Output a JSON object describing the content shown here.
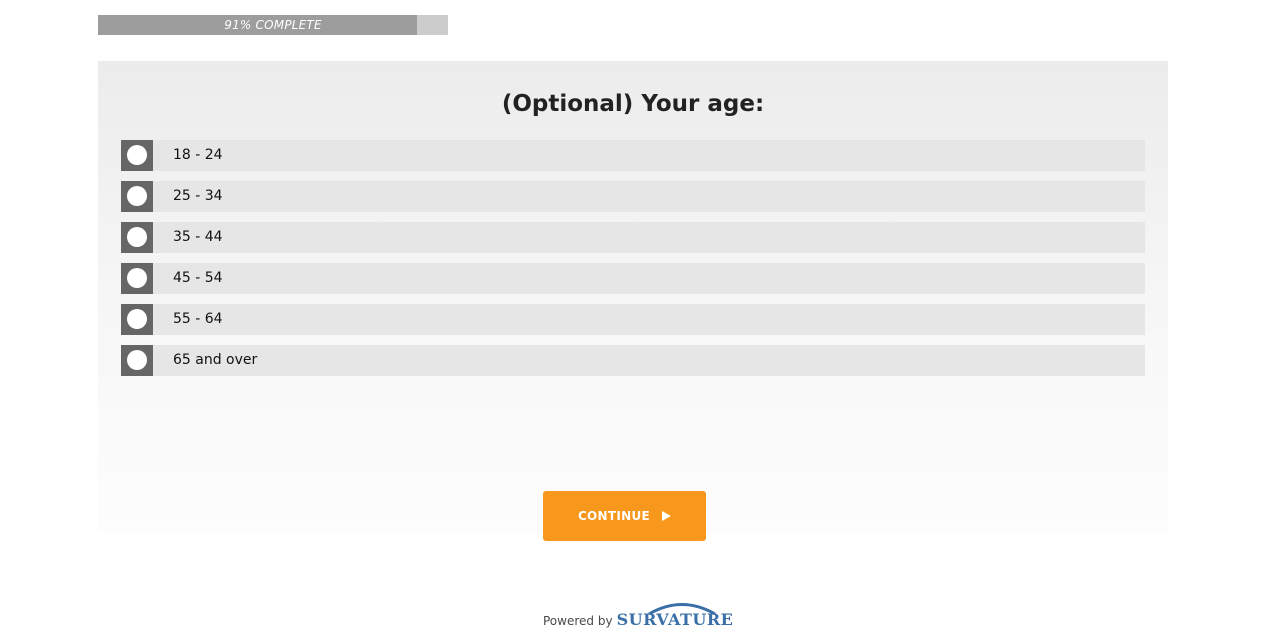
{
  "progress": {
    "percent": 91,
    "label": "91% COMPLETE"
  },
  "question": {
    "title": "(Optional) Your age:",
    "options": [
      {
        "label": "18 - 24"
      },
      {
        "label": "25 - 34"
      },
      {
        "label": "35 - 44"
      },
      {
        "label": "45 - 54"
      },
      {
        "label": "55 - 64"
      },
      {
        "label": "65 and over"
      }
    ]
  },
  "continue_button": {
    "label": "CONTINUE",
    "icon": "play-icon",
    "color": "#f7981d"
  },
  "footer": {
    "powered_by": "Powered by",
    "logo_text": "SURVATURE",
    "logo_color": "#3a6fa8"
  }
}
